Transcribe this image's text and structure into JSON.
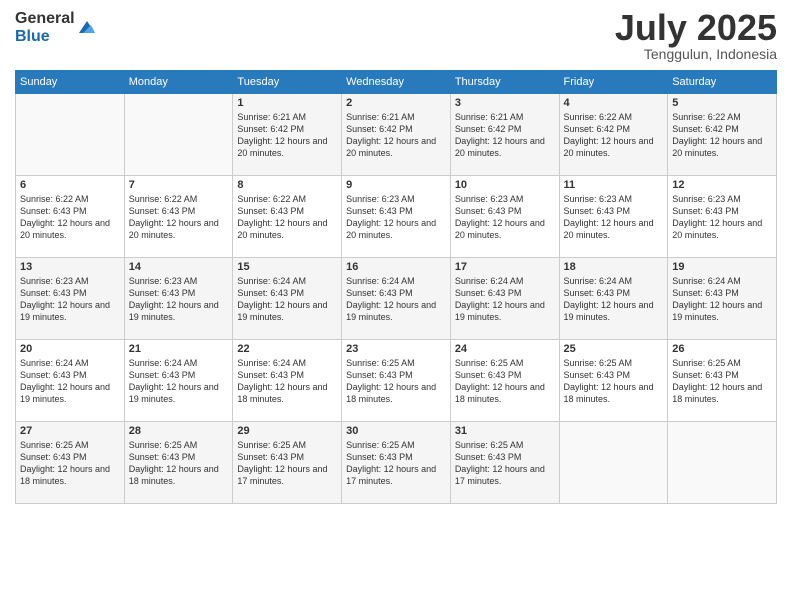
{
  "logo": {
    "general": "General",
    "blue": "Blue"
  },
  "header": {
    "month": "July 2025",
    "location": "Tenggulun, Indonesia"
  },
  "weekdays": [
    "Sunday",
    "Monday",
    "Tuesday",
    "Wednesday",
    "Thursday",
    "Friday",
    "Saturday"
  ],
  "weeks": [
    [
      {
        "day": "",
        "info": ""
      },
      {
        "day": "",
        "info": ""
      },
      {
        "day": "1",
        "info": "Sunrise: 6:21 AM\nSunset: 6:42 PM\nDaylight: 12 hours and 20 minutes."
      },
      {
        "day": "2",
        "info": "Sunrise: 6:21 AM\nSunset: 6:42 PM\nDaylight: 12 hours and 20 minutes."
      },
      {
        "day": "3",
        "info": "Sunrise: 6:21 AM\nSunset: 6:42 PM\nDaylight: 12 hours and 20 minutes."
      },
      {
        "day": "4",
        "info": "Sunrise: 6:22 AM\nSunset: 6:42 PM\nDaylight: 12 hours and 20 minutes."
      },
      {
        "day": "5",
        "info": "Sunrise: 6:22 AM\nSunset: 6:42 PM\nDaylight: 12 hours and 20 minutes."
      }
    ],
    [
      {
        "day": "6",
        "info": "Sunrise: 6:22 AM\nSunset: 6:43 PM\nDaylight: 12 hours and 20 minutes."
      },
      {
        "day": "7",
        "info": "Sunrise: 6:22 AM\nSunset: 6:43 PM\nDaylight: 12 hours and 20 minutes."
      },
      {
        "day": "8",
        "info": "Sunrise: 6:22 AM\nSunset: 6:43 PM\nDaylight: 12 hours and 20 minutes."
      },
      {
        "day": "9",
        "info": "Sunrise: 6:23 AM\nSunset: 6:43 PM\nDaylight: 12 hours and 20 minutes."
      },
      {
        "day": "10",
        "info": "Sunrise: 6:23 AM\nSunset: 6:43 PM\nDaylight: 12 hours and 20 minutes."
      },
      {
        "day": "11",
        "info": "Sunrise: 6:23 AM\nSunset: 6:43 PM\nDaylight: 12 hours and 20 minutes."
      },
      {
        "day": "12",
        "info": "Sunrise: 6:23 AM\nSunset: 6:43 PM\nDaylight: 12 hours and 20 minutes."
      }
    ],
    [
      {
        "day": "13",
        "info": "Sunrise: 6:23 AM\nSunset: 6:43 PM\nDaylight: 12 hours and 19 minutes."
      },
      {
        "day": "14",
        "info": "Sunrise: 6:23 AM\nSunset: 6:43 PM\nDaylight: 12 hours and 19 minutes."
      },
      {
        "day": "15",
        "info": "Sunrise: 6:24 AM\nSunset: 6:43 PM\nDaylight: 12 hours and 19 minutes."
      },
      {
        "day": "16",
        "info": "Sunrise: 6:24 AM\nSunset: 6:43 PM\nDaylight: 12 hours and 19 minutes."
      },
      {
        "day": "17",
        "info": "Sunrise: 6:24 AM\nSunset: 6:43 PM\nDaylight: 12 hours and 19 minutes."
      },
      {
        "day": "18",
        "info": "Sunrise: 6:24 AM\nSunset: 6:43 PM\nDaylight: 12 hours and 19 minutes."
      },
      {
        "day": "19",
        "info": "Sunrise: 6:24 AM\nSunset: 6:43 PM\nDaylight: 12 hours and 19 minutes."
      }
    ],
    [
      {
        "day": "20",
        "info": "Sunrise: 6:24 AM\nSunset: 6:43 PM\nDaylight: 12 hours and 19 minutes."
      },
      {
        "day": "21",
        "info": "Sunrise: 6:24 AM\nSunset: 6:43 PM\nDaylight: 12 hours and 19 minutes."
      },
      {
        "day": "22",
        "info": "Sunrise: 6:24 AM\nSunset: 6:43 PM\nDaylight: 12 hours and 18 minutes."
      },
      {
        "day": "23",
        "info": "Sunrise: 6:25 AM\nSunset: 6:43 PM\nDaylight: 12 hours and 18 minutes."
      },
      {
        "day": "24",
        "info": "Sunrise: 6:25 AM\nSunset: 6:43 PM\nDaylight: 12 hours and 18 minutes."
      },
      {
        "day": "25",
        "info": "Sunrise: 6:25 AM\nSunset: 6:43 PM\nDaylight: 12 hours and 18 minutes."
      },
      {
        "day": "26",
        "info": "Sunrise: 6:25 AM\nSunset: 6:43 PM\nDaylight: 12 hours and 18 minutes."
      }
    ],
    [
      {
        "day": "27",
        "info": "Sunrise: 6:25 AM\nSunset: 6:43 PM\nDaylight: 12 hours and 18 minutes."
      },
      {
        "day": "28",
        "info": "Sunrise: 6:25 AM\nSunset: 6:43 PM\nDaylight: 12 hours and 18 minutes."
      },
      {
        "day": "29",
        "info": "Sunrise: 6:25 AM\nSunset: 6:43 PM\nDaylight: 12 hours and 17 minutes."
      },
      {
        "day": "30",
        "info": "Sunrise: 6:25 AM\nSunset: 6:43 PM\nDaylight: 12 hours and 17 minutes."
      },
      {
        "day": "31",
        "info": "Sunrise: 6:25 AM\nSunset: 6:43 PM\nDaylight: 12 hours and 17 minutes."
      },
      {
        "day": "",
        "info": ""
      },
      {
        "day": "",
        "info": ""
      }
    ]
  ]
}
